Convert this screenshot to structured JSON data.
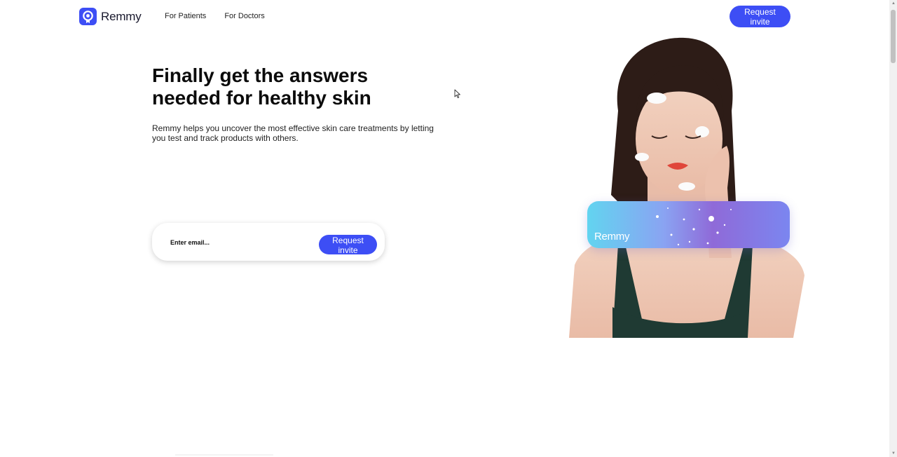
{
  "header": {
    "logo_text": "Remmy",
    "nav": [
      "For Patients",
      "For Doctors"
    ],
    "cta_label": "Request invite"
  },
  "hero": {
    "title_line1": "Finally get the answers",
    "title_line2": "needed for healthy skin",
    "subtitle": "Remmy helps you uncover the most effective skin care treatments by letting you test and track products with others.",
    "email_placeholder": "Enter email...",
    "invite_label": "Request invite"
  },
  "card": {
    "label": "Remmy"
  },
  "colors": {
    "accent": "#3d4ef5"
  }
}
